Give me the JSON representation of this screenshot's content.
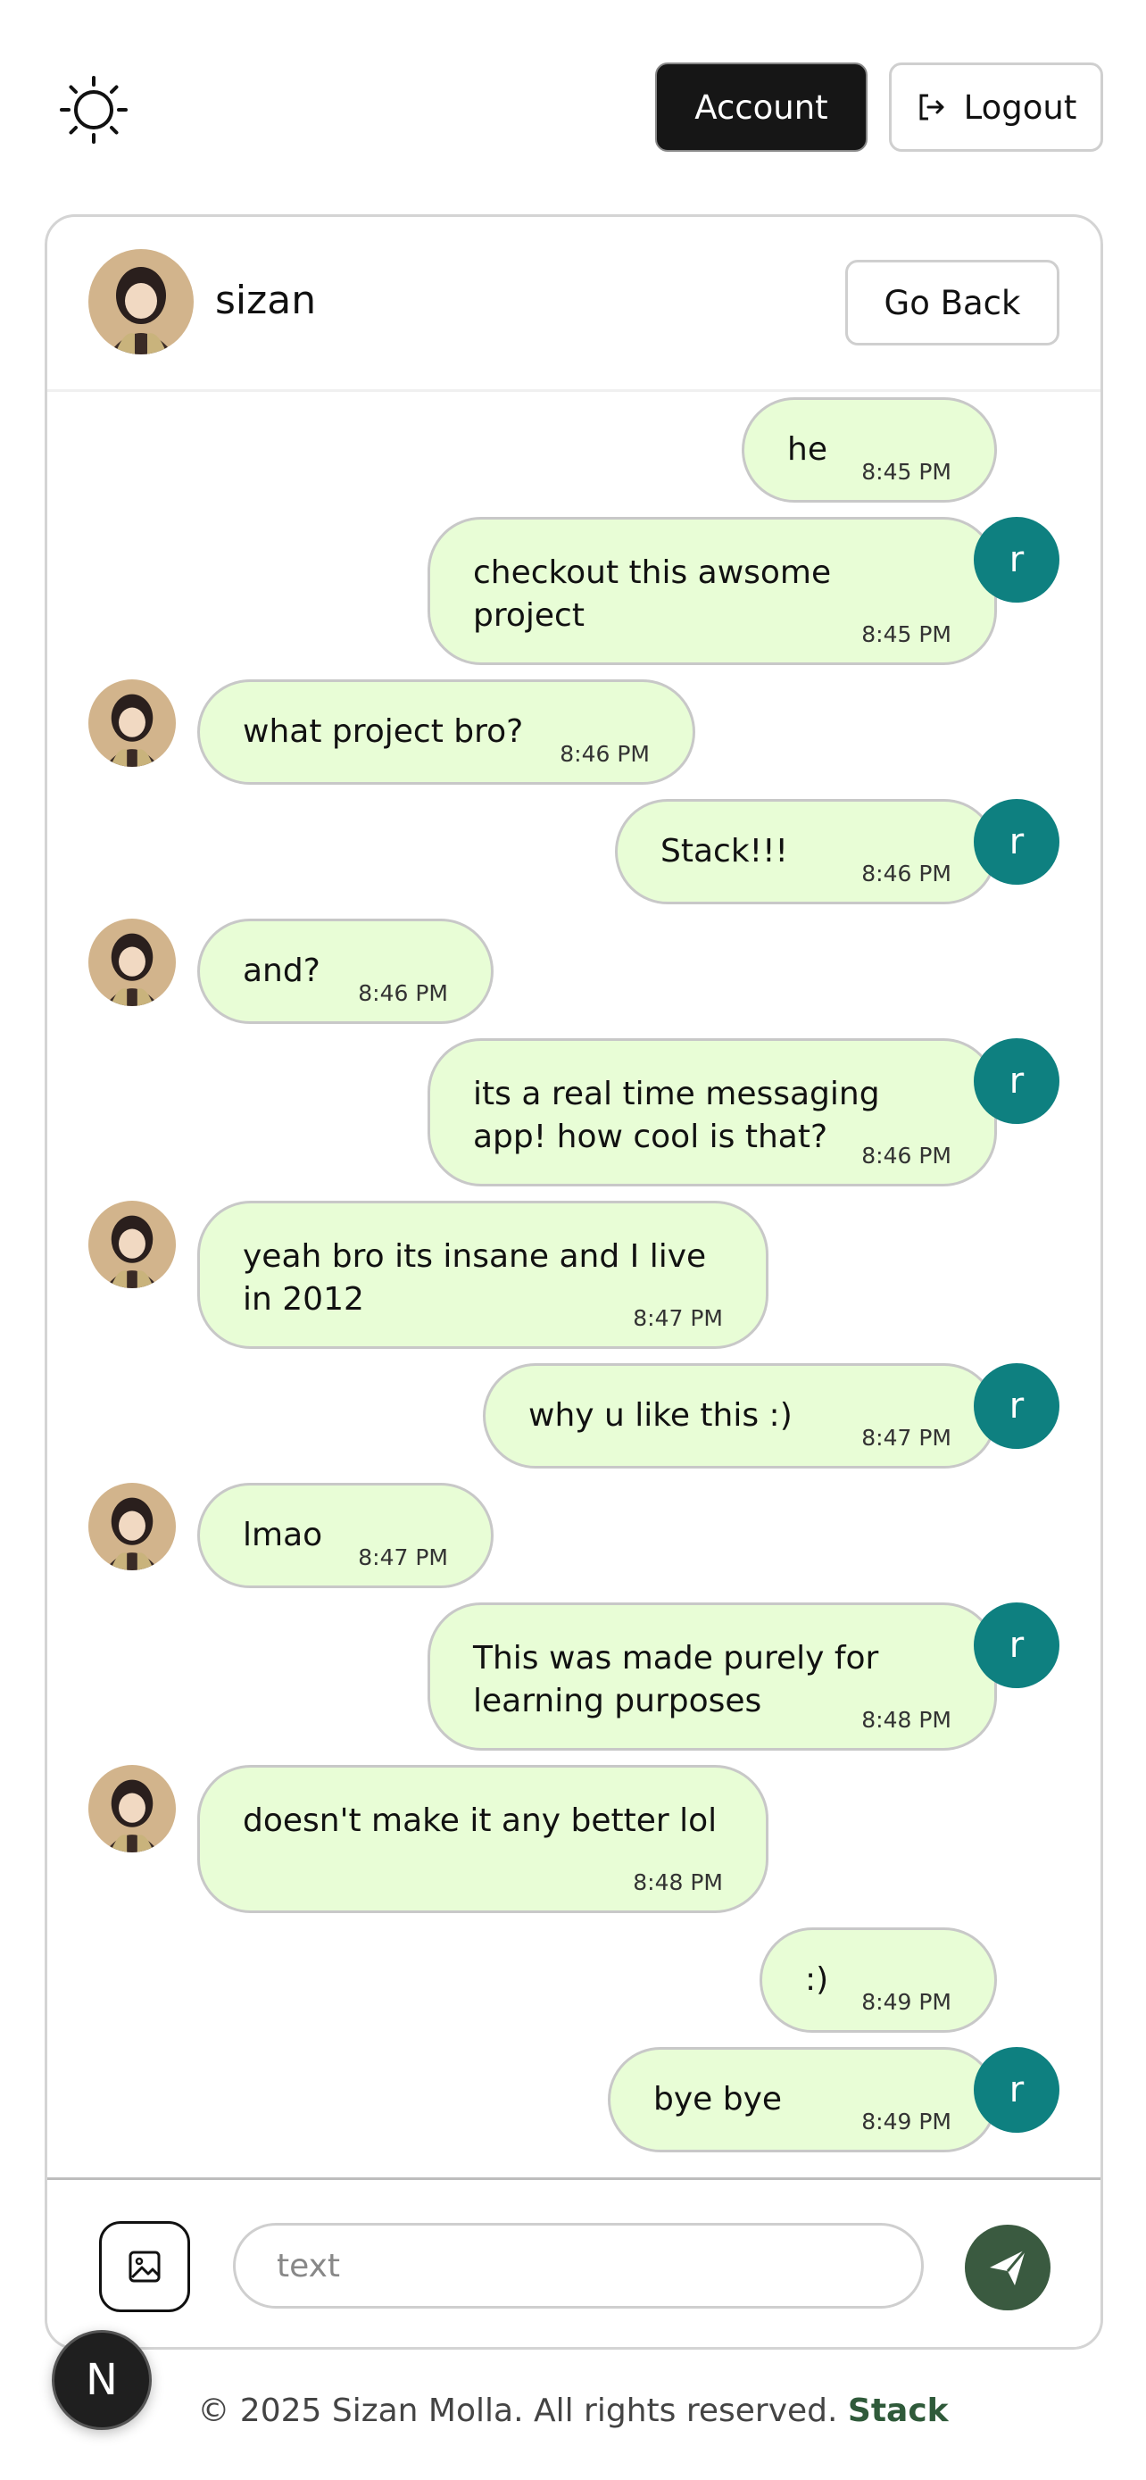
{
  "topbar": {
    "theme_icon": "sun-icon",
    "account_label": "Account",
    "logout_label": "Logout",
    "logout_icon": "logout-icon"
  },
  "chat": {
    "contact_name": "sizan",
    "back_label": "Go Back",
    "messages": [
      {
        "side": "right",
        "text": "he",
        "time": "8:45 PM",
        "avatar": false
      },
      {
        "side": "right",
        "text": "checkout this awsome\nproject",
        "time": "8:45 PM",
        "avatar": "r"
      },
      {
        "side": "left",
        "text": "what project bro?",
        "time": "8:46 PM",
        "avatar": true
      },
      {
        "side": "right",
        "text": "Stack!!!",
        "time": "8:46 PM",
        "avatar": "r"
      },
      {
        "side": "left",
        "text": "and?",
        "time": "8:46 PM",
        "avatar": true
      },
      {
        "side": "right",
        "text": "its a real time messaging\napp! how cool is that?",
        "time": "8:46 PM",
        "avatar": "r"
      },
      {
        "side": "left",
        "text": "yeah bro its insane and I live\nin 2012",
        "time": "8:47 PM",
        "avatar": true
      },
      {
        "side": "right",
        "text": "why u like this :)",
        "time": "8:47 PM",
        "avatar": "r"
      },
      {
        "side": "left",
        "text": "lmao",
        "time": "8:47 PM",
        "avatar": true
      },
      {
        "side": "right",
        "text": "This was made purely for\nlearning purposes",
        "time": "8:48 PM",
        "avatar": "r"
      },
      {
        "side": "left",
        "text": "doesn't make it any better lol",
        "time": "8:48 PM",
        "avatar": true
      },
      {
        "side": "right",
        "text": ":)",
        "time": "8:49 PM",
        "avatar": false
      },
      {
        "side": "right",
        "text": "bye bye",
        "time": "8:49 PM",
        "avatar": "r"
      }
    ],
    "input_placeholder": "text",
    "image_icon": "image-icon",
    "send_icon": "send-icon"
  },
  "badge": {
    "letter": "N"
  },
  "footer": {
    "text": "© 2025 Sizan Molla. All rights reserved.",
    "brand": "Stack"
  },
  "colors": {
    "bubble": "#e8fdd6",
    "avatar_r": "#0e8080",
    "send": "#3a5a40",
    "brand": "#2f5a3a"
  }
}
